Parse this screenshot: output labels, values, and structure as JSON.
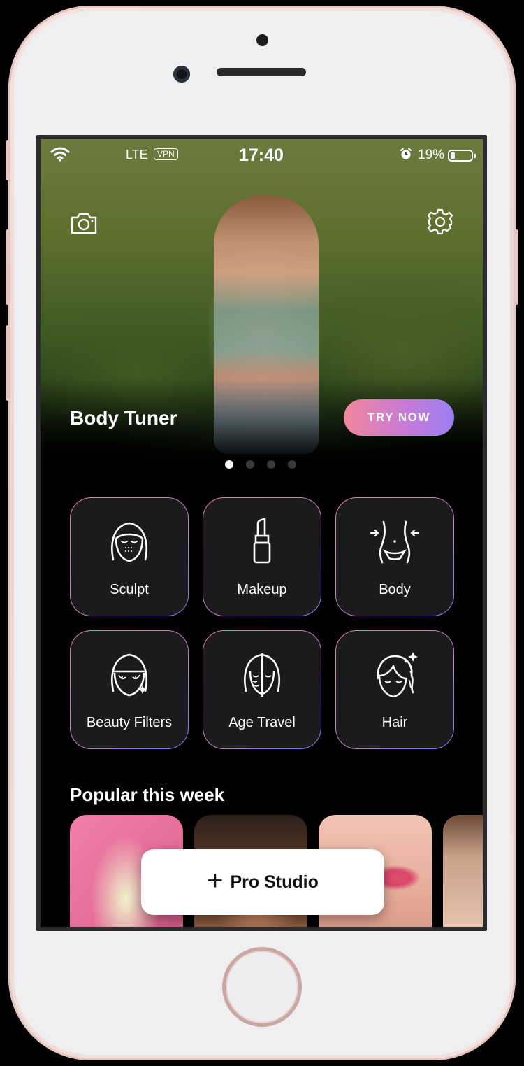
{
  "status_bar": {
    "carrier": "LTE",
    "vpn": "VPN",
    "time": "17:40",
    "battery": "19%",
    "battery_level": 0.19
  },
  "hero": {
    "title": "Body Tuner",
    "cta": "TRY NOW",
    "cta_gradient": [
      "#f1879a",
      "#c87ad7",
      "#9b7ff0"
    ],
    "page_count": 4,
    "active_page": 1
  },
  "features": [
    {
      "label": "Sculpt",
      "icon": "face-sculpt-icon"
    },
    {
      "label": "Makeup",
      "icon": "lipstick-icon"
    },
    {
      "label": "Body",
      "icon": "waist-icon"
    },
    {
      "label": "Beauty Filters",
      "icon": "face-sparkle-icon"
    },
    {
      "label": "Age Travel",
      "icon": "half-face-icon"
    },
    {
      "label": "Hair",
      "icon": "hair-sparkle-icon"
    }
  ],
  "popular": {
    "title": "Popular this week"
  },
  "pro_studio": {
    "label": "Pro Studio"
  }
}
